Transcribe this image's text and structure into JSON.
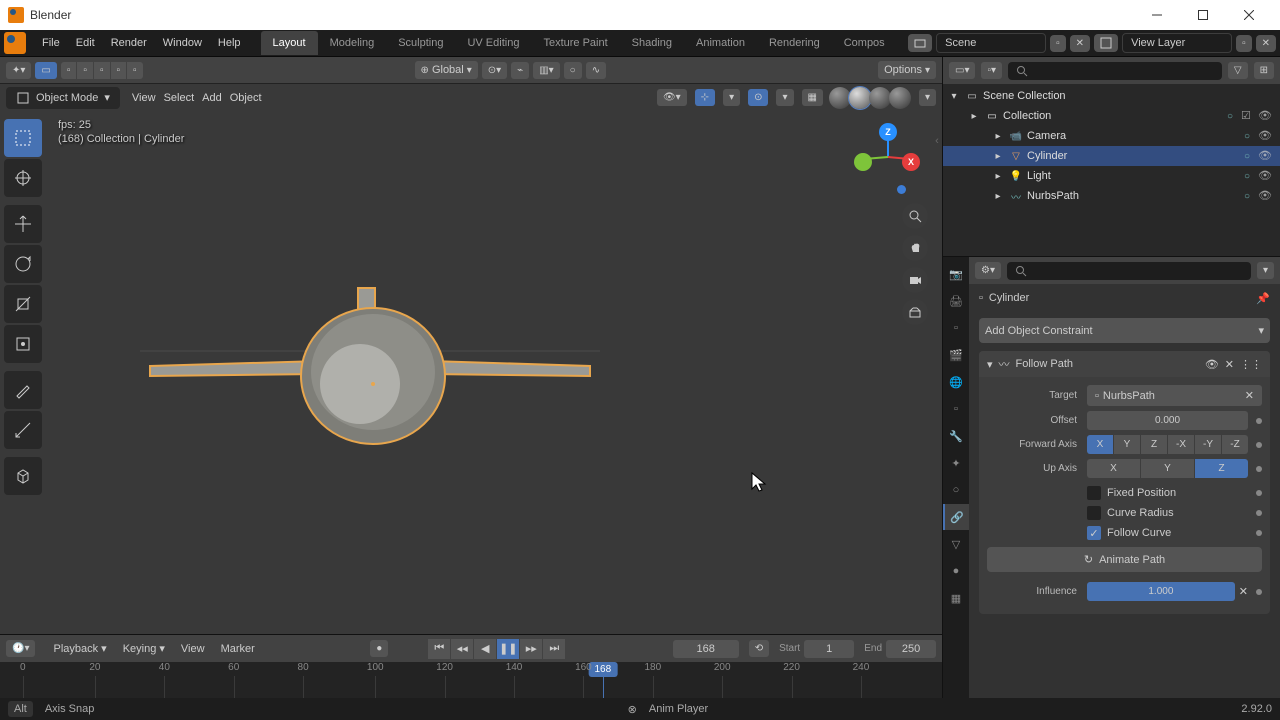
{
  "window": {
    "title": "Blender",
    "version": "2.92.0"
  },
  "menubar": {
    "items": [
      "File",
      "Edit",
      "Render",
      "Window",
      "Help"
    ],
    "scene_label": "Scene",
    "viewlayer_label": "View Layer"
  },
  "workspace_tabs": [
    "Layout",
    "Modeling",
    "Sculpting",
    "UV Editing",
    "Texture Paint",
    "Shading",
    "Animation",
    "Rendering",
    "Compos"
  ],
  "active_workspace": 0,
  "viewport_header": {
    "orientation": "Global",
    "options": "Options"
  },
  "viewport_header2": {
    "mode": "Object Mode",
    "menus": [
      "View",
      "Select",
      "Add",
      "Object"
    ]
  },
  "viewport_info": {
    "fps": "fps: 25",
    "collection": "(168) Collection | Cylinder"
  },
  "gizmo": {
    "x": "X",
    "y": "",
    "z": "Z"
  },
  "timeline": {
    "menus": [
      "Playback",
      "Keying",
      "View",
      "Marker"
    ],
    "current_frame": "168",
    "start_label": "Start",
    "start_value": "1",
    "end_label": "End",
    "end_value": "250",
    "ticks": [
      "0",
      "20",
      "40",
      "60",
      "80",
      "100",
      "120",
      "140",
      "160",
      "180",
      "200",
      "220",
      "240"
    ],
    "playhead_frame": "168"
  },
  "outliner": {
    "root": "Scene Collection",
    "items": [
      {
        "name": "Collection",
        "indent": 16,
        "type": "collection",
        "selected": false
      },
      {
        "name": "Camera",
        "indent": 40,
        "type": "camera",
        "selected": false
      },
      {
        "name": "Cylinder",
        "indent": 40,
        "type": "mesh",
        "selected": true
      },
      {
        "name": "Light",
        "indent": 40,
        "type": "light",
        "selected": false
      },
      {
        "name": "NurbsPath",
        "indent": 40,
        "type": "curve",
        "selected": false
      }
    ]
  },
  "properties": {
    "object_name": "Cylinder",
    "add_constraint_label": "Add Object Constraint",
    "constraint": {
      "name": "Follow Path",
      "target_label": "Target",
      "target_value": "NurbsPath",
      "offset_label": "Offset",
      "offset_value": "0.000",
      "forward_axis_label": "Forward Axis",
      "forward_axis_options": [
        "X",
        "Y",
        "Z",
        "-X",
        "-Y",
        "-Z"
      ],
      "forward_axis_active": 0,
      "up_axis_label": "Up Axis",
      "up_axis_options": [
        "X",
        "Y",
        "Z"
      ],
      "up_axis_active": 2,
      "fixed_position_label": "Fixed Position",
      "curve_radius_label": "Curve Radius",
      "follow_curve_label": "Follow Curve",
      "follow_curve_checked": true,
      "animate_path_label": "Animate Path",
      "influence_label": "Influence",
      "influence_value": "1.000"
    }
  },
  "statusbar": {
    "hint1": "Axis Snap",
    "hint_key": "Alt",
    "anim_player": "Anim Player"
  }
}
